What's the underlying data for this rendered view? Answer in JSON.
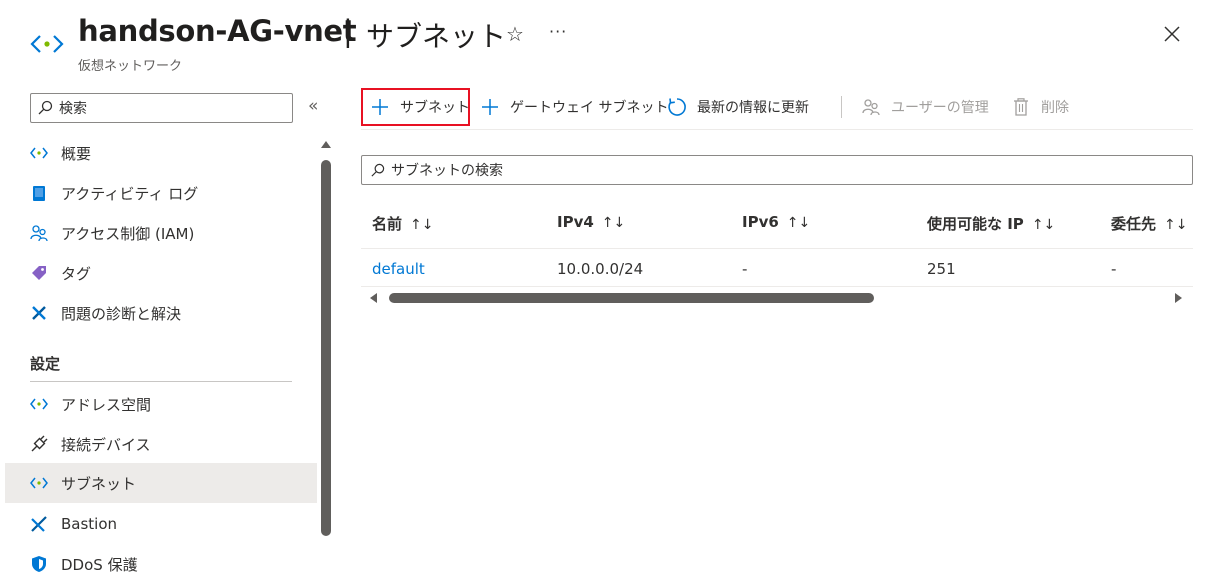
{
  "header": {
    "title": "handson-AG-vnet",
    "separator": "|",
    "page": "サブネット",
    "subtitle": "仮想ネットワーク",
    "star": "☆",
    "more": "···",
    "icon": "vnet-icon"
  },
  "sidebar": {
    "search_placeholder": "検索",
    "collapse": "«",
    "items_top": [
      {
        "label": "概要",
        "icon": "vnet-icon"
      },
      {
        "label": "アクティビティ ログ",
        "icon": "activity-log-icon"
      },
      {
        "label": "アクセス制御 (IAM)",
        "icon": "people-icon"
      },
      {
        "label": "タグ",
        "icon": "tag-icon"
      },
      {
        "label": "問題の診断と解決",
        "icon": "wrench-icon"
      }
    ],
    "section_label": "設定",
    "items_settings": [
      {
        "label": "アドレス空間",
        "icon": "vnet-icon"
      },
      {
        "label": "接続デバイス",
        "icon": "plug-icon"
      },
      {
        "label": "サブネット",
        "icon": "vnet-icon",
        "active": true
      },
      {
        "label": "Bastion",
        "icon": "bastion-icon"
      },
      {
        "label": "DDoS 保護",
        "icon": "shield-icon"
      }
    ]
  },
  "toolbar": {
    "add_subnet": "サブネット",
    "add_gateway_subnet": "ゲートウェイ サブネット",
    "refresh": "最新の情報に更新",
    "manage_users": "ユーザーの管理",
    "delete": "削除"
  },
  "filter": {
    "placeholder": "サブネットの検索"
  },
  "table": {
    "sort_glyph": "↑↓",
    "columns": [
      "名前",
      "IPv4",
      "IPv6",
      "使用可能な IP",
      "委任先"
    ],
    "rows": [
      [
        "default",
        "10.0.0.0/24",
        "-",
        "251",
        "-"
      ]
    ]
  },
  "colors": {
    "accent": "#0078d4",
    "highlight_border": "#e81123",
    "active_bg": "#edebe9"
  }
}
